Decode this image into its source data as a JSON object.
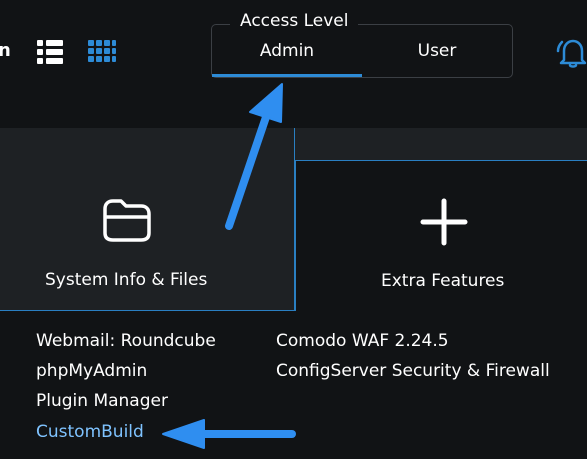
{
  "header": {
    "partial_text": "n",
    "access_level": {
      "legend": "Access Level",
      "tabs": [
        {
          "label": "Admin",
          "active": true
        },
        {
          "label": "User",
          "active": false
        }
      ]
    }
  },
  "cards": [
    {
      "label": "System Info & Files",
      "icon": "folder-icon"
    },
    {
      "label": "Extra Features",
      "icon": "plus-icon"
    }
  ],
  "links_left": [
    {
      "label": "Webmail: Roundcube"
    },
    {
      "label": "phpMyAdmin"
    },
    {
      "label": "Plugin Manager"
    },
    {
      "label": "CustomBuild",
      "highlighted": true
    }
  ],
  "links_right": [
    {
      "label": "Comodo WAF 2.24.5"
    },
    {
      "label": "ConfigServer Security & Firewall"
    }
  ],
  "colors": {
    "accent": "#2d8bd6",
    "highlight_link": "#7fc3ff",
    "annotation_arrow": "#2f8ef0"
  }
}
